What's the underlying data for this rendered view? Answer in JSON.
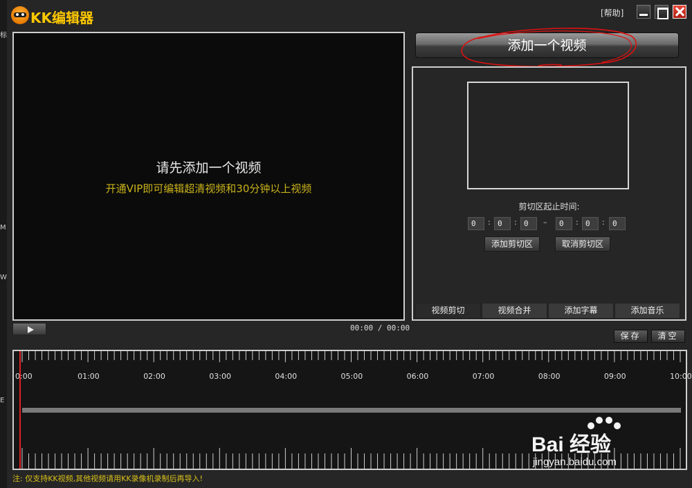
{
  "app": {
    "title": "KK编辑器",
    "help": "[帮助]"
  },
  "edge_chars": [
    "标",
    "M",
    "W",
    "E"
  ],
  "preview": {
    "main_text": "请先添加一个视频",
    "sub_text": "开通VIP即可编辑超清视频和30分钟以上视频",
    "time_display": "00:00 / 00:00"
  },
  "add_video_button": "添加一个视频",
  "cut_panel": {
    "label": "剪切区起止时间:",
    "start": [
      "0",
      "0",
      "0"
    ],
    "end": [
      "0",
      "0",
      "0"
    ],
    "separator": ":",
    "dash": "–",
    "add_button": "添加剪切区",
    "cancel_button": "取消剪切区"
  },
  "tabs": [
    "视频剪切",
    "视频合并",
    "添加字幕",
    "添加音乐"
  ],
  "actions": {
    "save": "保存",
    "clear": "清空"
  },
  "timeline": {
    "labels": [
      "0:00",
      "01:00",
      "02:00",
      "03:00",
      "04:00",
      "05:00",
      "06:00",
      "07:00",
      "08:00",
      "09:00",
      "10:00"
    ]
  },
  "footer_note": "注: 仅支持KK视频,其他视频请用KK录像机录制后再导入!",
  "watermark": {
    "brand": "Bai 经验",
    "site": "jingyan.baidu.com"
  },
  "colors": {
    "accent_yellow": "#c9b21a",
    "playhead": "#e02020",
    "annotation": "#e01010"
  }
}
